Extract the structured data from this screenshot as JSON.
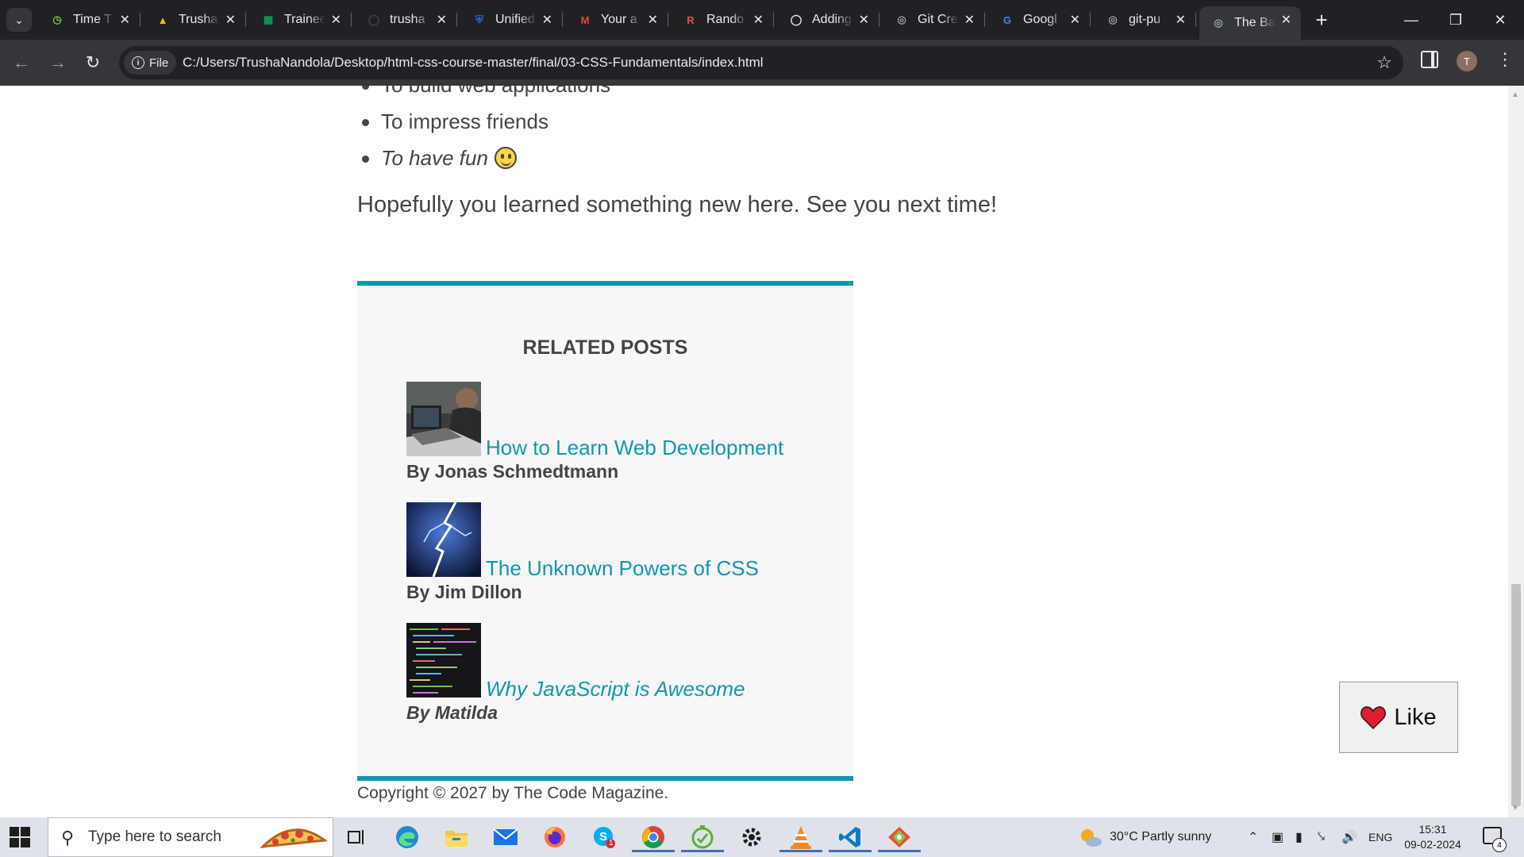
{
  "browser": {
    "tabs": [
      {
        "title": "Time T",
        "favicon": "timer-icon",
        "color": "#7cc242"
      },
      {
        "title": "Trusha",
        "favicon": "google-drive-icon",
        "color": "#fbbc04"
      },
      {
        "title": "Trainee",
        "favicon": "google-sheets-icon",
        "color": "#0f9d58"
      },
      {
        "title": "trusha",
        "favicon": "github-icon",
        "color": "#444"
      },
      {
        "title": "Unified",
        "favicon": "shield-icon",
        "color": "#1a73e8"
      },
      {
        "title": "Your a",
        "favicon": "gmail-icon",
        "color": "#ea4335"
      },
      {
        "title": "Rando",
        "favicon": "r-logo-icon",
        "color": "#e8543f"
      },
      {
        "title": "Adding",
        "favicon": "github-icon",
        "color": "#e8eaed"
      },
      {
        "title": "Git Cre",
        "favicon": "globe-icon",
        "color": "#9aa0a6"
      },
      {
        "title": "Googl",
        "favicon": "google-icon",
        "color": "#4285f4"
      },
      {
        "title": "git-pu",
        "favicon": "globe-icon",
        "color": "#9aa0a6"
      },
      {
        "title": "The Ba",
        "favicon": "globe-icon",
        "color": "#9aa0a6",
        "active": true
      }
    ],
    "chip_label": "File",
    "url": "C:/Users/TrushaNandola/Desktop/html-css-course-master/final/03-CSS-Fundamentals/index.html",
    "avatar_letter": "T"
  },
  "article": {
    "bullets": [
      "To build web applications",
      "To impress friends",
      "To have fun"
    ],
    "closing": "Hopefully you learned something new here. See you next time!"
  },
  "related": {
    "heading": "RELATED POSTS",
    "posts": [
      {
        "title": "How to Learn Web Development",
        "author": "By Jonas Schmedtmann",
        "thumb": "laptop-photo"
      },
      {
        "title": "The Unknown Powers of CSS",
        "author": "By Jim Dillon",
        "thumb": "lightning-photo"
      },
      {
        "title": "Why JavaScript is Awesome",
        "author": "By Matilda",
        "thumb": "code-photo"
      }
    ]
  },
  "footer": {
    "copyright": "Copyright © 2027 by The Code Magazine."
  },
  "like_button": {
    "label": "Like"
  },
  "taskbar": {
    "search_placeholder": "Type here to search",
    "weather": "30°C  Partly sunny",
    "language": "ENG",
    "time": "15:31",
    "date": "09-02-2024",
    "notification_count": "4",
    "pinned_badge": "1"
  },
  "colors": {
    "accent": "#1098ad",
    "text": "#444444",
    "like_heart": "#e11d2e"
  }
}
